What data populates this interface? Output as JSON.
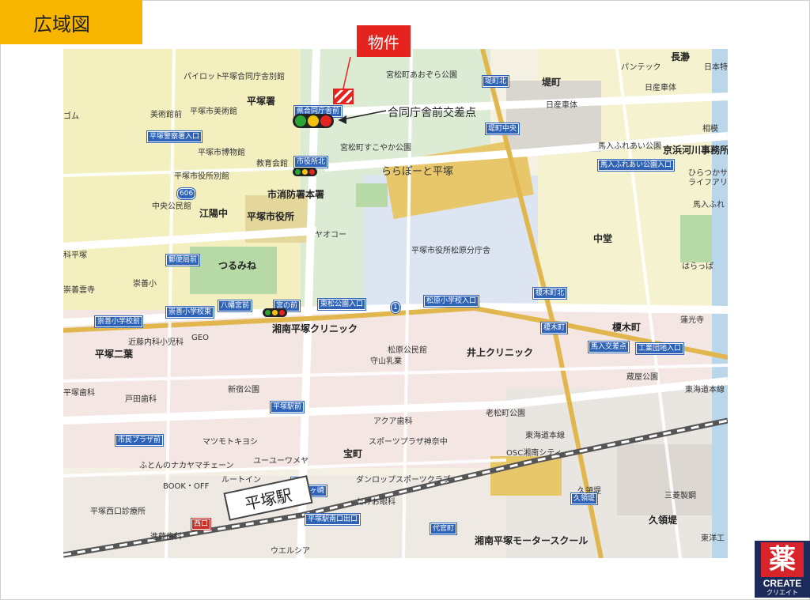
{
  "page": {
    "title": "広域図",
    "property_label": "物件",
    "intersection_label": "合同庁舎前交差点"
  },
  "map": {
    "station_label": "平塚駅",
    "place_labels": [
      {
        "text": "パイロット"
      },
      {
        "text": "平塚合同庁舎別館"
      },
      {
        "text": "宮松町あおぞら公園"
      },
      {
        "text": "堤町"
      },
      {
        "text": "パンテック"
      },
      {
        "text": "長瀞"
      },
      {
        "text": "日本特"
      },
      {
        "text": "日産車体"
      },
      {
        "text": "日産車体"
      },
      {
        "text": "ゴム"
      },
      {
        "text": "平塚市美術館"
      },
      {
        "text": "平塚署"
      },
      {
        "text": "美術館前"
      },
      {
        "text": "相模"
      },
      {
        "text": "宮松町すこやか公園"
      },
      {
        "text": "馬入ふれあい公園"
      },
      {
        "text": "京浜河川事務所"
      },
      {
        "text": "平塚市博物館"
      },
      {
        "text": "教育会館"
      },
      {
        "text": "ららぽーと平塚"
      },
      {
        "text": "ひらつかサン・"
      },
      {
        "text": "ライフアリーナ"
      },
      {
        "text": "平塚市役所別館"
      },
      {
        "text": "市消防署本署"
      },
      {
        "text": "馬入ふれ"
      },
      {
        "text": "中央公民館"
      },
      {
        "text": "江陽中"
      },
      {
        "text": "平塚市役所"
      },
      {
        "text": "ヤオコー"
      },
      {
        "text": "中堂"
      },
      {
        "text": "平塚市役所松原分庁舎"
      },
      {
        "text": "科平塚"
      },
      {
        "text": "つるみね"
      },
      {
        "text": "はらっぱ"
      },
      {
        "text": "崇善小"
      },
      {
        "text": "崇善雲寺"
      },
      {
        "text": "湘南平塚クリニック"
      },
      {
        "text": "榎木町"
      },
      {
        "text": "蓮光寺"
      },
      {
        "text": "近藤内科小児科"
      },
      {
        "text": "GEO"
      },
      {
        "text": "松原公民館"
      },
      {
        "text": "井上クリニック"
      },
      {
        "text": "平塚二葉"
      },
      {
        "text": "守山乳業"
      },
      {
        "text": "蔵屋公園"
      },
      {
        "text": "平塚歯科"
      },
      {
        "text": "新宿公園"
      },
      {
        "text": "戸田歯科"
      },
      {
        "text": "東海道本線"
      },
      {
        "text": "アクア歯科"
      },
      {
        "text": "老松町公園"
      },
      {
        "text": "スポーツプラザ神奈中"
      },
      {
        "text": "マツモトキヨシ"
      },
      {
        "text": "宝町"
      },
      {
        "text": "東海道本線"
      },
      {
        "text": "ユーユーワメヤ"
      },
      {
        "text": "OSC湘南シティ"
      },
      {
        "text": "ふとんのナカヤマチェーン"
      },
      {
        "text": "BOOK・OFF"
      },
      {
        "text": "ルートイン"
      },
      {
        "text": "ダンロップスポーツクラブ"
      },
      {
        "text": "久領堤"
      },
      {
        "text": "三菱製鋼"
      },
      {
        "text": "たけお眼科"
      },
      {
        "text": "久領堤"
      },
      {
        "text": "平塚西口診療所"
      },
      {
        "text": "湘南平塚モータースクール"
      },
      {
        "text": "東洋工"
      },
      {
        "text": "進藤歯科"
      },
      {
        "text": "ウエルシア"
      }
    ],
    "road_signs": [
      {
        "text": "平塚警察署入口"
      },
      {
        "text": "県合同庁舎前"
      },
      {
        "text": "堤町北"
      },
      {
        "text": "堤町中央"
      },
      {
        "text": "市役所北"
      },
      {
        "text": "馬入ふれあい公園入口"
      },
      {
        "text": "郵便局前"
      },
      {
        "text": "八幡宮前"
      },
      {
        "text": "宮の前"
      },
      {
        "text": "東松公園入口"
      },
      {
        "text": "松原小学校入口"
      },
      {
        "text": "榎木町北"
      },
      {
        "text": "崇善小学校前"
      },
      {
        "text": "崇善小学校東"
      },
      {
        "text": "榎木町"
      },
      {
        "text": "馬入交差点"
      },
      {
        "text": "工業団地入口"
      },
      {
        "text": "平塚駅前"
      },
      {
        "text": "市民プラザ前"
      },
      {
        "text": "平塚駅南口出口"
      },
      {
        "text": "代官町"
      },
      {
        "text": "久領堤"
      },
      {
        "text": "西口"
      },
      {
        "text": "茅ヶ崎"
      },
      {
        "text": "本"
      }
    ],
    "route_shields": [
      {
        "text": "606"
      },
      {
        "text": "1"
      }
    ]
  },
  "logo": {
    "kanji": "薬",
    "brand": "CREATE",
    "kana": "クリエイト"
  },
  "colors": {
    "title_bg": "#f7b500",
    "property_red": "#e52420",
    "road_sign_blue": "#2f63b7",
    "logo_navy": "#1c2b5a",
    "logo_red": "#d8232a"
  }
}
